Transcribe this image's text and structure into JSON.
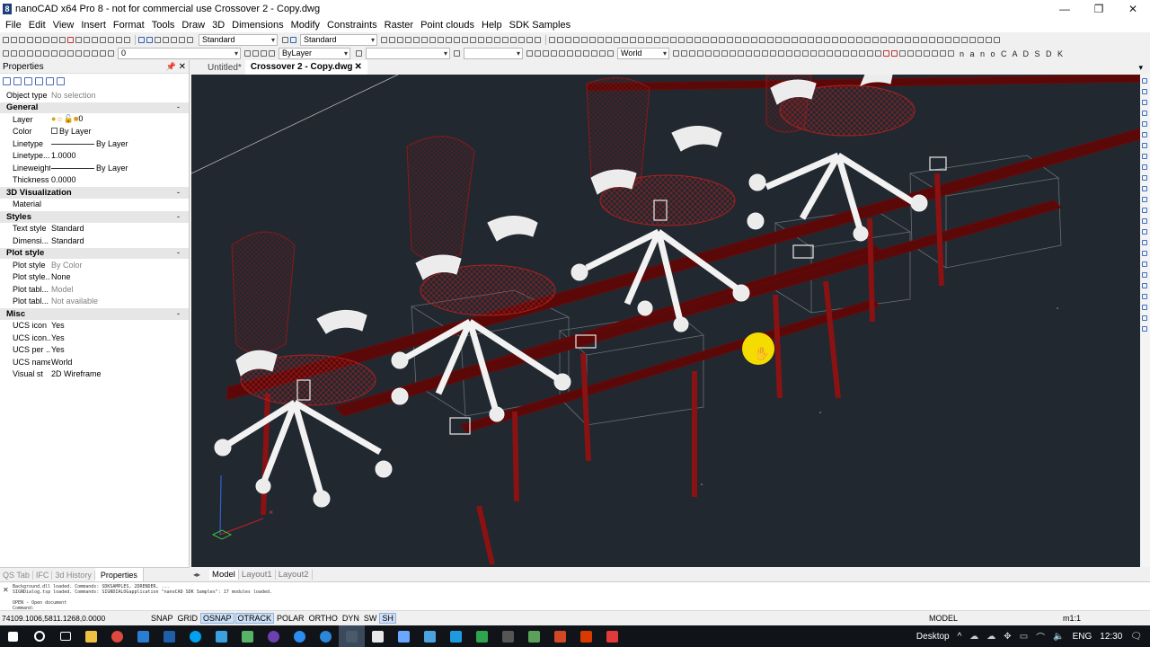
{
  "window": {
    "title": "nanoCAD x64 Pro 8 - not for commercial use Crossover 2 - Copy.dwg",
    "app_icon": "8",
    "minimize": "—",
    "maximize": "❐",
    "close": "✕"
  },
  "menu": [
    "File",
    "Edit",
    "View",
    "Insert",
    "Format",
    "Tools",
    "Draw",
    "3D",
    "Dimensions",
    "Modify",
    "Constraints",
    "Raster",
    "Point clouds",
    "Help",
    "SDK Samples"
  ],
  "toolbar": {
    "text_style": "Standard",
    "dim_style": "Standard",
    "layer": "0",
    "color": "ByLayer",
    "linetype": "",
    "ucs": "World",
    "nano_sdk": "n a n o C A D  S D K"
  },
  "properties": {
    "title": "Properties",
    "pin": "📌",
    "close": "✕",
    "object_type_label": "Object type",
    "object_type_value": "No selection",
    "sections": {
      "general": "General",
      "visualization": "3D Visualization",
      "styles": "Styles",
      "plot_style": "Plot style",
      "misc": "Misc"
    },
    "collapse": "-",
    "rows": {
      "layer": {
        "k": "Layer",
        "v": "0"
      },
      "color": {
        "k": "Color",
        "v": "By Layer"
      },
      "linetype": {
        "k": "Linetype",
        "v": "By Layer"
      },
      "linetype_scale": {
        "k": "Linetype...",
        "v": "1.0000"
      },
      "lineweight": {
        "k": "Lineweight",
        "v": "By Layer"
      },
      "thickness": {
        "k": "Thickness",
        "v": "0.0000"
      },
      "material": {
        "k": "Material",
        "v": ""
      },
      "text_style": {
        "k": "Text style",
        "v": "Standard"
      },
      "dim_style": {
        "k": "Dimensi...",
        "v": "Standard"
      },
      "plot_style": {
        "k": "Plot style",
        "v": "By Color"
      },
      "plot_style_table": {
        "k": "Plot style...",
        "v": "None"
      },
      "plot_table_attached": {
        "k": "Plot tabl...",
        "v": "Model"
      },
      "plot_table_type": {
        "k": "Plot tabl...",
        "v": "Not available"
      },
      "ucs_icon": {
        "k": "UCS icon",
        "v": "Yes"
      },
      "ucs_icon_origin": {
        "k": "UCS icon...",
        "v": "Yes"
      },
      "ucs_per_viewport": {
        "k": "UCS per ...",
        "v": "Yes"
      },
      "ucs_name": {
        "k": "UCS name",
        "v": "World"
      },
      "visual_style": {
        "k": "Visual st",
        "v": "2D Wireframe"
      }
    }
  },
  "left_tabs": [
    "QS Tab",
    "IFC",
    "3d History",
    "Properties"
  ],
  "doc_tabs": {
    "untitled": "Untitled*",
    "active": "Crossover 2 - Copy.dwg",
    "close": "✕",
    "overflow": "▾"
  },
  "layout_tabs": {
    "nav": "◂▸",
    "tabs": [
      "Model",
      "Layout1",
      "Layout2"
    ]
  },
  "command_line": {
    "close": "✕",
    "lines": [
      "Background.dll loaded. Commands: SDKSAMPLES, 2DRENDER, ...",
      "SIGNDialog.tsp loaded. Commands: SIGNDIALOGapplication \"nanoCAD SDK Samples\": 17 modules loaded.",
      "OPEN - Open document",
      "Command:"
    ]
  },
  "status_bar": {
    "coords": "74109.1006,5811.1268,0.0000",
    "toggles": [
      {
        "label": "SNAP",
        "on": false
      },
      {
        "label": "GRID",
        "on": false
      },
      {
        "label": "OSNAP",
        "on": true
      },
      {
        "label": "OTRACK",
        "on": true
      },
      {
        "label": "POLAR",
        "on": false
      },
      {
        "label": "ORTHO",
        "on": false
      },
      {
        "label": "DYN",
        "on": false
      },
      {
        "label": "SW",
        "on": false
      },
      {
        "label": "SH",
        "on": true
      }
    ],
    "model": "MODEL",
    "scale": "m1:1"
  },
  "taskbar": {
    "desktop": "Desktop",
    "lang": "ENG",
    "time": "12:30",
    "up_arrow": "^",
    "notif": "🗨",
    "app_colors": [
      "#ffffff",
      "#ffffff",
      "#ffffff",
      "#f0c040",
      "#e0483e",
      "#2b7cd3",
      "#1f5fa8",
      "#0078d4",
      "#00a1f1",
      "#3aa0e0",
      "#58b368",
      "#6e3fb0",
      "#2d8cf0",
      "#2b88d8",
      "#4a5a6a",
      "#e8e8e8",
      "#6aa7ff",
      "#4aa3df",
      "#1e9be0",
      "#2ea44f",
      "#555555",
      "#5aa15a",
      "#d24726",
      "#d83b01",
      "#e23a3a"
    ]
  },
  "cursor": {
    "color": "#f5dc00"
  }
}
